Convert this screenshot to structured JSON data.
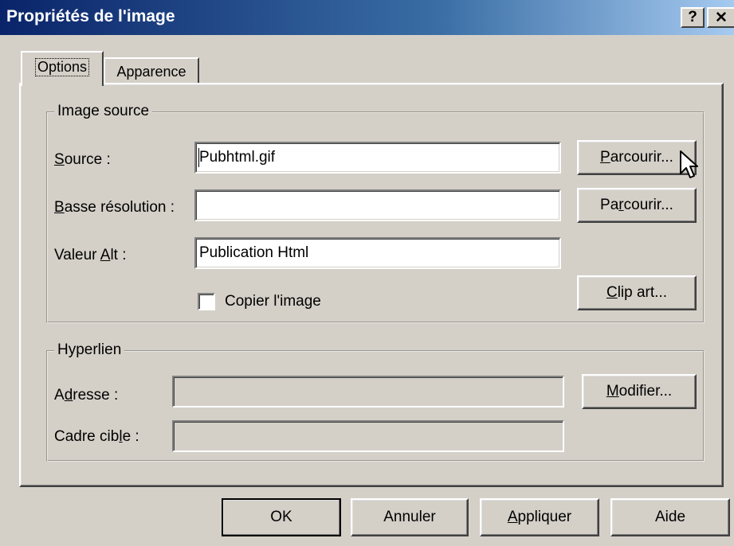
{
  "window": {
    "title": "Propriétés de l'image",
    "help_glyph": "?",
    "close_glyph": "✕"
  },
  "tabs": [
    {
      "label": "Options",
      "active": true
    },
    {
      "label": "Apparence",
      "active": false
    }
  ],
  "image_source": {
    "legend": "Image source",
    "source_label_hot": "S",
    "source_label_rest": "ource :",
    "source_value": "Pubhtml.gif",
    "low_res_label_hot": "B",
    "low_res_label_rest": "asse résolution :",
    "low_res_value": "",
    "alt_label_pre": "Valeur ",
    "alt_label_hot": "A",
    "alt_label_rest": "lt :",
    "alt_value": "Publication Html",
    "browse1_hot": "P",
    "browse1_rest": "arcourir...",
    "browse2_pre": "Pa",
    "browse2_hot": "r",
    "browse2_rest": "courir...",
    "copy_label": "Copier l'image",
    "copy_checked": false,
    "clipart_hot": "C",
    "clipart_rest": "lip art..."
  },
  "hyperlink": {
    "legend": "Hyperlien",
    "address_label_pre": "A",
    "address_label_hot": "d",
    "address_label_rest": "resse :",
    "address_value": "",
    "target_label_pre": "Cadre cib",
    "target_label_hot": "l",
    "target_label_rest": "e :",
    "target_value": "",
    "modify_hot": "M",
    "modify_rest": "odifier..."
  },
  "footer": {
    "ok_label": "OK",
    "cancel_label": "Annuler",
    "apply_hot": "A",
    "apply_rest": "ppliquer",
    "help_label": "Aide"
  }
}
